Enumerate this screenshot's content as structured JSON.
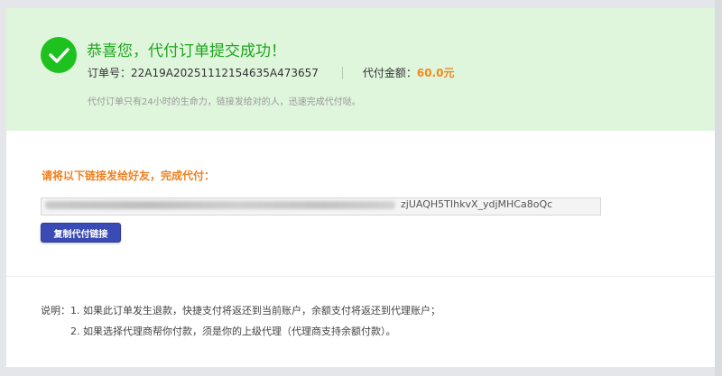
{
  "success": {
    "title": "恭喜您，代付订单提交成功！",
    "order_label": "订单号：",
    "order_number": "22A19A20251112154635A473657",
    "amount_label": "代付金额：",
    "amount_value": "60.0元",
    "note": "代付订单只有24小时的生命力，链接发给对的人，迅速完成代付哒。"
  },
  "share": {
    "heading": "请将以下链接发给好友，完成代付：",
    "link_visible_tail": "zjUAQH5TIhkvX_ydjMHCa8oQc",
    "copy_button": "复制代付链接"
  },
  "description": {
    "label": "说明：",
    "items": [
      "1. 如果此订单发生退款，快捷支付将返还到当前账户，余额支付将返还到代理账户；",
      "2. 如果选择代理商帮你付款，须是你的上级代理（代理商支持余额付款）。"
    ]
  },
  "colors": {
    "success_green": "#1ec21e",
    "title_green": "#1ea61e",
    "band_bg": "#dff5dc",
    "accent_orange": "#f08a1c",
    "button_blue": "#3b4bb5"
  },
  "icons": {
    "success": "check-circle-icon"
  }
}
